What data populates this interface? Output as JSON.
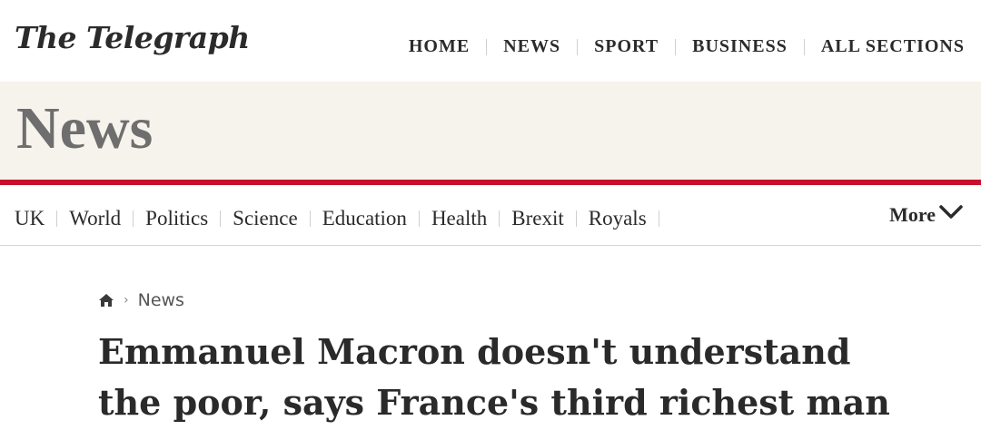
{
  "logo": {
    "text": "The Telegraph"
  },
  "main_nav": [
    "HOME",
    "NEWS",
    "SPORT",
    "BUSINESS",
    "ALL SECTIONS"
  ],
  "section": {
    "title": "News"
  },
  "sub_nav": [
    "UK",
    "World",
    "Politics",
    "Science",
    "Education",
    "Health",
    "Brexit",
    "Royals"
  ],
  "more": {
    "label": "More",
    "icon": "chevron-down-icon"
  },
  "breadcrumb": {
    "home_icon": "home-icon",
    "current": "News"
  },
  "article": {
    "headline_line1": "Emmanuel Macron doesn't understand",
    "headline_line2": "the poor, says France's third richest man"
  },
  "colors": {
    "accent_red": "#c8102e",
    "band": "#f6f3ec",
    "text": "#2b2b2b"
  }
}
